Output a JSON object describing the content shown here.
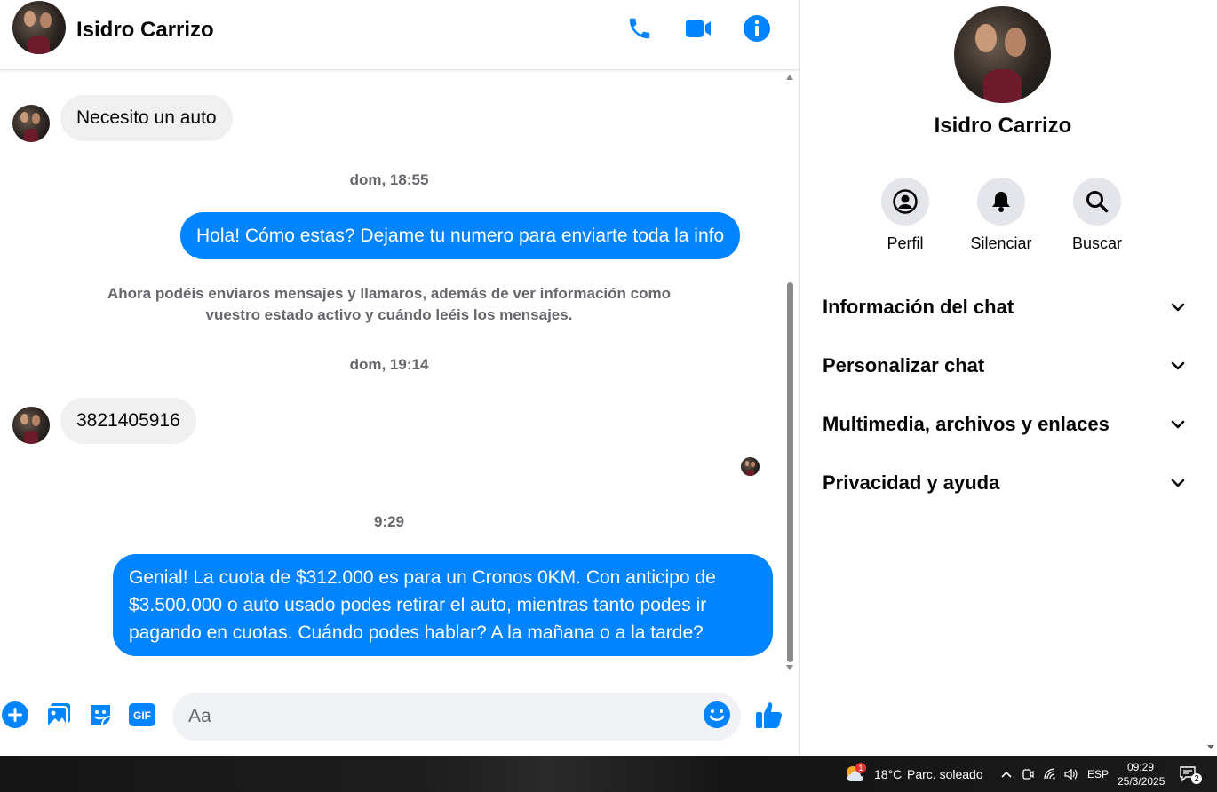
{
  "contact": {
    "name": "Isidro Carrizo"
  },
  "header": {
    "icons": [
      "phone-icon",
      "video-camera-icon",
      "info-icon"
    ]
  },
  "messages": [
    {
      "direction": "in",
      "text": "Necesito un auto"
    },
    {
      "type": "timestamp",
      "text": "dom, 18:55"
    },
    {
      "direction": "out",
      "text": "Hola! Cómo estas? Dejame tu numero para enviarte toda la info"
    },
    {
      "type": "system",
      "text": "Ahora podéis enviaros mensajes y llamaros, además de ver información como vuestro estado activo y cuándo leéis los mensajes."
    },
    {
      "type": "timestamp",
      "text": "dom, 19:14"
    },
    {
      "direction": "in",
      "text": "3821405916"
    },
    {
      "type": "timestamp",
      "text": "9:29"
    },
    {
      "direction": "out",
      "text": "Genial! La cuota de $312.000 es para un Cronos 0KM. Con anticipo de $3.500.000 o auto usado podes retirar el auto, mientras tanto podes ir pagando en cuotas. Cuándo podes hablar? A la mañana o a la tarde?"
    }
  ],
  "composer": {
    "placeholder": "Aa"
  },
  "info_panel": {
    "actions": [
      {
        "label": "Perfil",
        "icon": "profile-icon"
      },
      {
        "label": "Silenciar",
        "icon": "bell-icon"
      },
      {
        "label": "Buscar",
        "icon": "search-icon"
      }
    ],
    "sections": [
      {
        "title": "Información del chat"
      },
      {
        "title": "Personalizar chat"
      },
      {
        "title": "Multimedia, archivos y enlaces"
      },
      {
        "title": "Privacidad y ayuda"
      }
    ]
  },
  "taskbar": {
    "weather_badge": "1",
    "temperature": "18°C",
    "condition": "Parc. soleado",
    "language": "ESP",
    "time": "09:29",
    "date": "25/3/2025",
    "notification_count": "2"
  },
  "colors": {
    "accent": "#0084ff",
    "incoming_bubble": "#f0f0f0",
    "muted_text": "#65676b"
  }
}
